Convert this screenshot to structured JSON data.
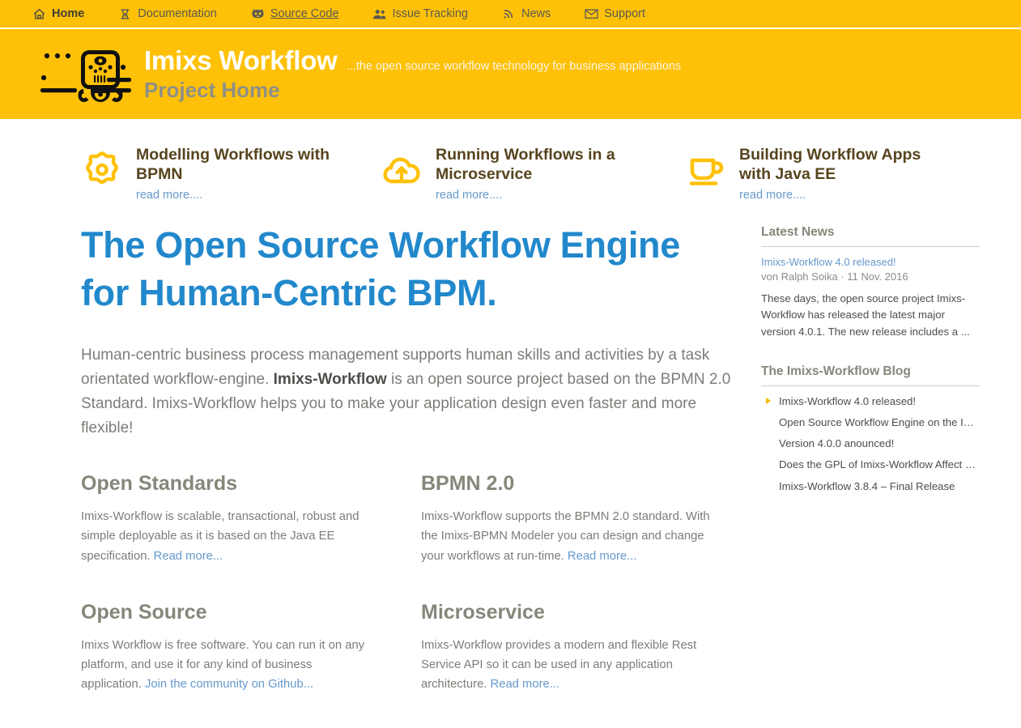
{
  "nav": {
    "items": [
      {
        "label": "Home",
        "icon": "home-icon",
        "state": "active"
      },
      {
        "label": "Documentation",
        "icon": "book-icon",
        "state": "normal"
      },
      {
        "label": "Source Code",
        "icon": "github-icon",
        "state": "underlined"
      },
      {
        "label": "Issue Tracking",
        "icon": "users-icon",
        "state": "normal"
      },
      {
        "label": "News",
        "icon": "rss-icon",
        "state": "normal"
      },
      {
        "label": "Support",
        "icon": "envelope-icon",
        "state": "normal"
      }
    ]
  },
  "banner": {
    "logo_icon": "imixs-mayan-glyph-logo",
    "brand": "Imixs Workflow",
    "tagline": "...the open source workflow technology for business applications",
    "subbrand": "Project Home"
  },
  "promos": [
    {
      "icon": "gear-icon",
      "title": "Modelling Workflows with BPMN",
      "link": "read more...."
    },
    {
      "icon": "cloud-upload-icon",
      "title": "Running Workflows in a Microservice",
      "link": "read more...."
    },
    {
      "icon": "coffee-cup-icon",
      "title": "Building Workflow Apps with Java EE",
      "link": "read more...."
    }
  ],
  "main": {
    "headline": "The Open Source Workflow Engine for Human-Centric BPM.",
    "intro": {
      "part1": "Human-centric business process management supports human skills and activities by a task orientated workflow-engine. ",
      "strong": "Imixs-Workflow",
      "part2": " is an open source project based on the BPMN 2.0 Standard. Imixs-Workflow helps you to make your application design even faster and more flexible!"
    },
    "features": [
      {
        "title": "Open Standards",
        "body": "Imixs-Workflow is scalable, transactional, robust and simple deployable as it is based on the Java EE specification. ",
        "link": "Read more..."
      },
      {
        "title": "BPMN 2.0",
        "body": "Imixs-Workflow supports the BPMN 2.0 standard. With the Imixs-BPMN Modeler you can design and change your workflows at run-time. ",
        "link": "Read more..."
      },
      {
        "title": "Open Source",
        "body": "Imixs Workflow is free software. You can run it on any platform, and use it for any kind of business application. ",
        "link": "Join the community on Github..."
      },
      {
        "title": "Microservice",
        "body": "Imixs-Workflow provides a modern and flexible Rest Service API so it can be used in any application architecture. ",
        "link": "Read more..."
      }
    ]
  },
  "sidebar": {
    "news_heading": "Latest News",
    "news": {
      "title": "Imixs-Workflow 4.0 released!",
      "meta": "von Ralph Soika · 11 Nov. 2016",
      "body": "These days, the open source project Imixs-Workflow has released the latest major version 4.0.1. The new release includes a ..."
    },
    "blog_heading": "The Imixs-Workflow Blog",
    "blog_items": [
      "Imixs-Workflow 4.0 released!",
      "Open Source Workflow Engine on the IT…",
      "Version 4.0.0 anounced!",
      "Does the GPL of Imixs-Workflow Affect …",
      "Imixs-Workflow 3.8.4 – Final Release"
    ]
  },
  "colors": {
    "amber": "#ffc107",
    "link_blue": "#6699cc",
    "headline_blue": "#2288cc",
    "heading_olive": "#84887a",
    "promo_brown": "#57441e"
  }
}
